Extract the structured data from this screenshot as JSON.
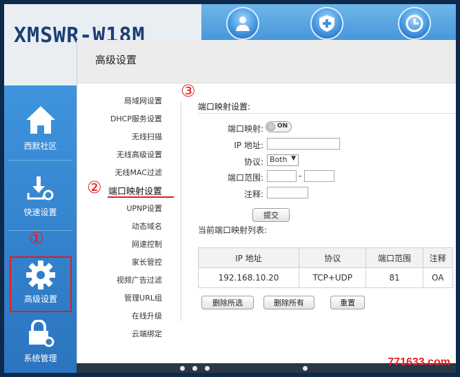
{
  "brand": "XMSWR-W18M",
  "page_title": "高级设置",
  "left_nav": [
    {
      "label": "西默社区",
      "icon": "home-icon"
    },
    {
      "label": "快速设置",
      "icon": "download-gear-icon"
    },
    {
      "label": "高级设置",
      "icon": "gear-icon"
    },
    {
      "label": "系统管理",
      "icon": "lock-gear-icon"
    }
  ],
  "top_icons": [
    "users-icon",
    "shield-icon",
    "clock-icon"
  ],
  "markers": {
    "m1": "①",
    "m2": "②",
    "m3": "③"
  },
  "submenu": [
    "局域网设置",
    "DHCP服务设置",
    "无线扫描",
    "无线高级设置",
    "无线MAC过滤",
    "端口映射设置",
    "UPNP设置",
    "动态域名",
    "网速控制",
    "家长管控",
    "视频广告过滤",
    "管理URL组",
    "在线升级",
    "云端绑定"
  ],
  "form": {
    "section_title": "端口映射设置:",
    "port_map_label": "端口映射:",
    "toggle_text": "ON",
    "ip_label": "IP 地址:",
    "protocol_label": "协议:",
    "protocol_value": "Both",
    "range_label": "端口范围:",
    "range_sep": "-",
    "note_label": "注释:",
    "submit": "提交"
  },
  "list": {
    "title": "当前端口映射列表:",
    "headers": [
      "IP 地址",
      "协议",
      "端口范围",
      "注释"
    ],
    "rows": [
      [
        "192.168.10.20",
        "TCP+UDP",
        "81",
        "OA"
      ]
    ]
  },
  "actions": {
    "delete_selected": "删除所选",
    "delete_all": "删除所有",
    "reset": "重置"
  },
  "watermark": "771633.com",
  "colors": {
    "accent_blue": "#3d8fd6",
    "marker_red": "#e31b1b"
  }
}
